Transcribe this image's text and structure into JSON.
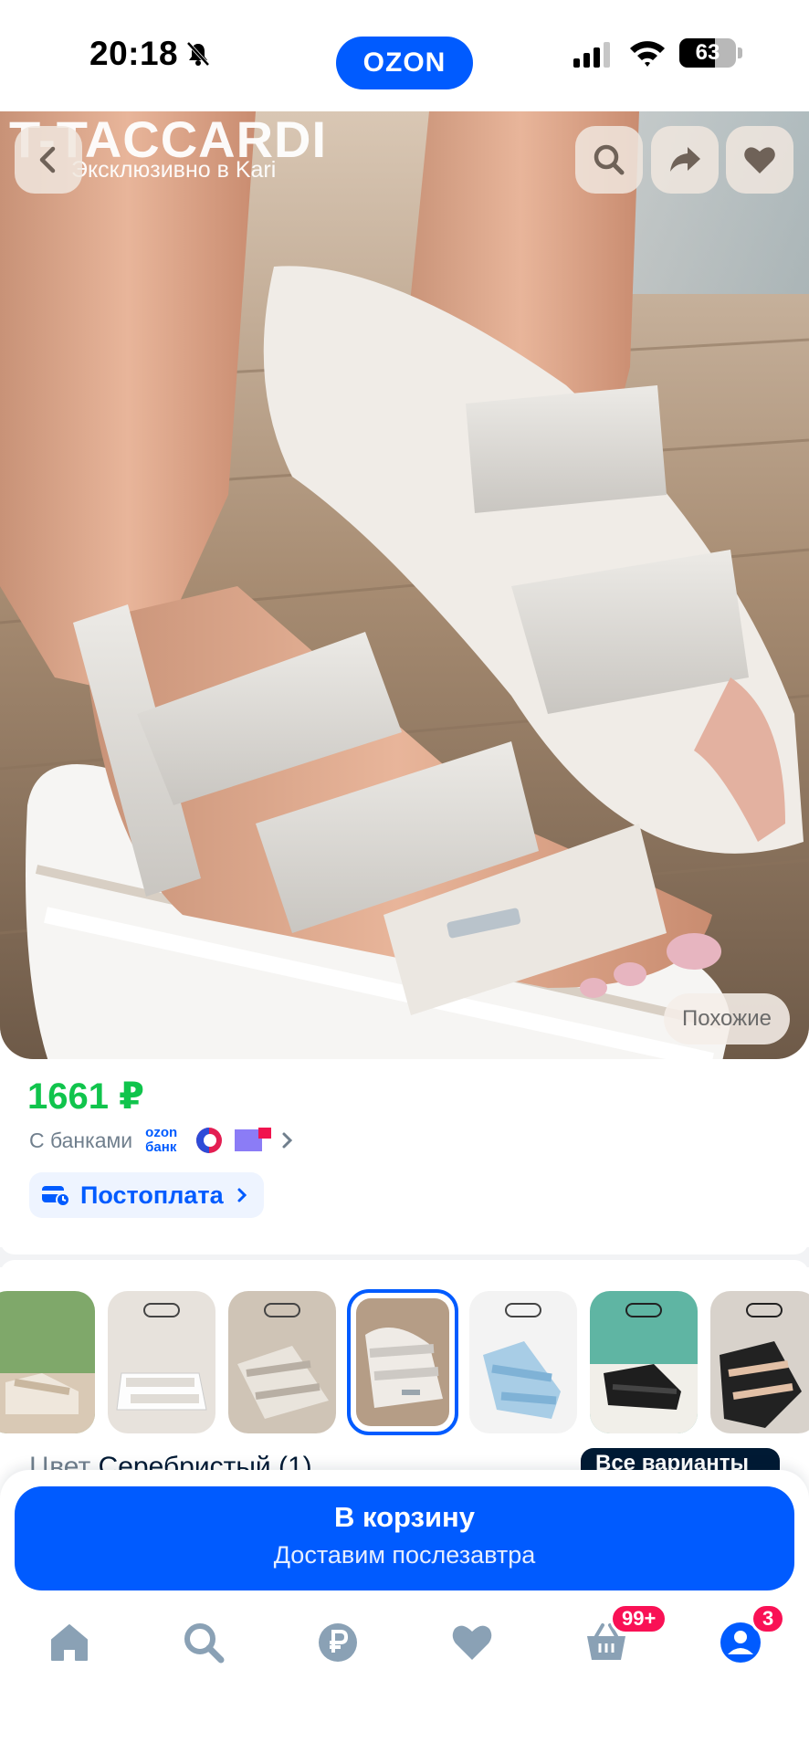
{
  "status_bar": {
    "time": "20:18",
    "app_logo": "OZON",
    "battery": "63",
    "battery_level": 0.63
  },
  "hero": {
    "brand_watermark": "T-TACCARDI",
    "brand_subline": "Эксклюзивно в Kari",
    "similar_label": "Похожие"
  },
  "price": {
    "value": "1661 ₽",
    "banks_label": "С банками",
    "ozon_bank_logo": "ozon банк",
    "postpay_label": "Постоплата"
  },
  "variants": {
    "color_label": "Цвет",
    "color_value": "Серебристый (1)",
    "all_label": "Все варианты",
    "items": [
      {
        "icon": "sandal-beige-thumb",
        "selected": false
      },
      {
        "icon": "sandal-white-thumb",
        "selected": false
      },
      {
        "icon": "sandal-grey-thumb",
        "selected": false
      },
      {
        "icon": "sandal-silver-thumb",
        "selected": true
      },
      {
        "icon": "sandal-blue-thumb",
        "selected": false
      },
      {
        "icon": "sandal-black-thumb",
        "selected": false
      },
      {
        "icon": "sandal-black-2-thumb",
        "selected": false
      }
    ]
  },
  "cart": {
    "button_label": "В корзину",
    "delivery_label": "Доставим послезавтра"
  },
  "tabbar": {
    "cart_badge": "99+",
    "profile_badge": "3",
    "accent": "#005bff",
    "badge_color": "#f91155"
  }
}
